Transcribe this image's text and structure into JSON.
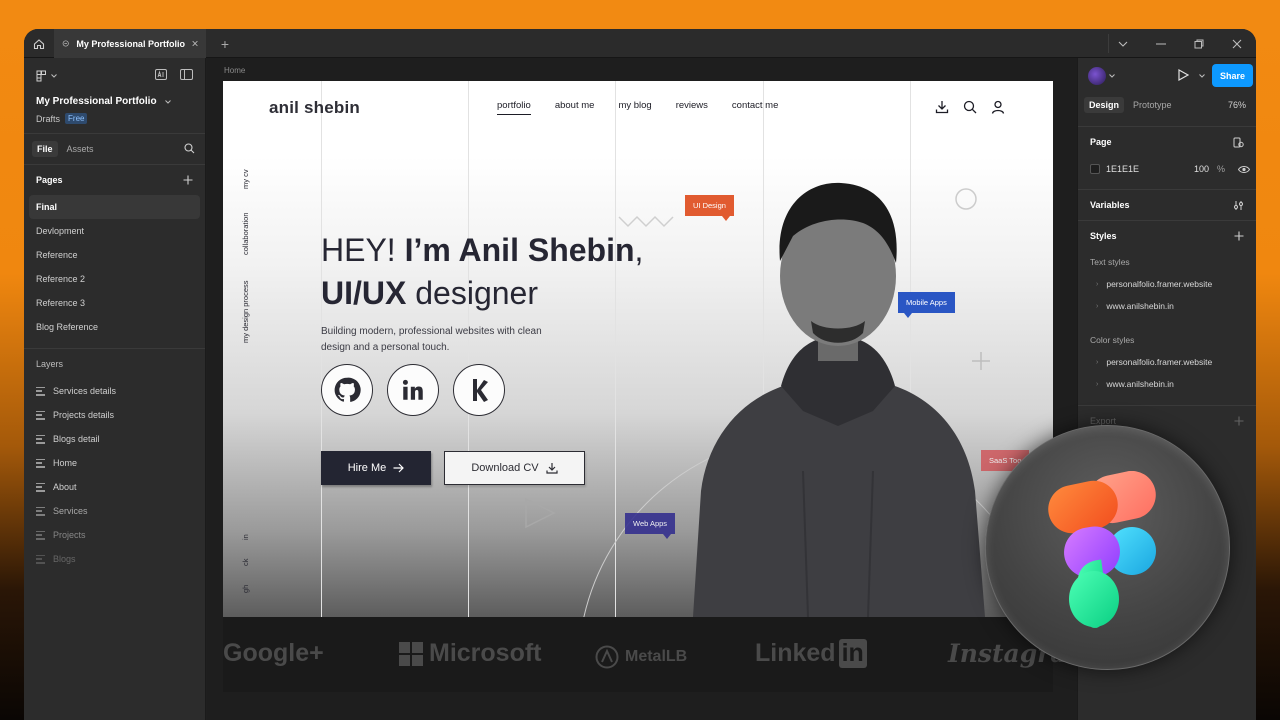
{
  "titlebar": {
    "tab_title": "My Professional Portfolio"
  },
  "left_panel": {
    "project_name": "My Professional Portfolio",
    "drafts_label": "Drafts",
    "plan_badge": "Free",
    "tabs": [
      "File",
      "Assets"
    ],
    "pages_heading": "Pages",
    "pages": [
      "Final",
      "Devlopment",
      "Reference",
      "Reference 2",
      "Reference 3",
      "Blog Reference"
    ],
    "layers_heading": "Layers",
    "layers": [
      "Services details",
      "Projects details",
      "Blogs detail",
      "Home",
      "About",
      "Services",
      "Projects",
      "Blogs"
    ]
  },
  "canvas": {
    "breadcrumb": "Home",
    "site": {
      "logo": "anil shebin",
      "nav": [
        "portfolio",
        "about me",
        "my blog",
        "reviews",
        "contact me"
      ],
      "side_links": [
        "my cv",
        "collaboration",
        "my design process"
      ],
      "social_short": [
        "in",
        "ck",
        "gh"
      ],
      "headline_pre": "HEY! ",
      "headline_bold": "I’m Anil Shebin",
      "headline_comma": ",",
      "headline2_bold": "UI/UX",
      "headline2_rest": " designer",
      "tagline": "Building modern, professional websites with clean design and a personal touch.",
      "hire_label": "Hire Me",
      "cv_label": "Download CV",
      "tags": [
        "UI Design",
        "Mobile Apps",
        "Web Apps",
        "SaaS Too"
      ],
      "brand_logos": [
        "Google+",
        "Microsoft",
        "MetalLB",
        "Linked",
        "in",
        "Instagram"
      ]
    }
  },
  "right_panel": {
    "share_label": "Share",
    "tabs": [
      "Design",
      "Prototype"
    ],
    "zoom": "76%",
    "page_heading": "Page",
    "page_fill_hex": "1E1E1E",
    "page_fill_opacity": "100",
    "page_fill_unit": "%",
    "variables_heading": "Variables",
    "styles_heading": "Styles",
    "text_styles_heading": "Text styles",
    "text_styles": [
      "personalfolio.framer.website",
      "www.anilshebin.in"
    ],
    "color_styles_heading": "Color styles",
    "color_styles": [
      "personalfolio.framer.website",
      "www.anilshebin.in"
    ],
    "export_heading": "Export"
  },
  "colors": {
    "accent_blue": "#0d99ff",
    "background_orange": "#f28a12",
    "tag_orange": "#e15b30",
    "tag_blue": "#2a56c4"
  }
}
